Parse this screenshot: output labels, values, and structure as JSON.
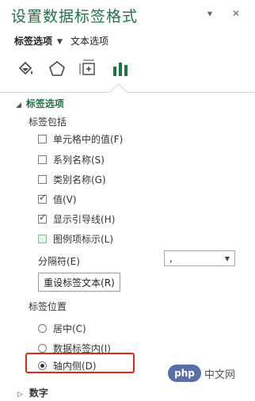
{
  "pane": {
    "title": "设置数据标签格式",
    "collapse_glyph": "▾",
    "close_glyph": "✕"
  },
  "tabs": {
    "label_options": "标签选项",
    "text_options": "文本选项"
  },
  "icons": [
    "fill-line-icon",
    "effects-icon",
    "size-properties-icon",
    "label-options-icon"
  ],
  "accent_color": "#217346",
  "section": {
    "title": "标签选项",
    "label_contains": "标签包括",
    "checkboxes": [
      {
        "label": "单元格中的值(F)",
        "checked": false
      },
      {
        "label": "系列名称(S)",
        "checked": false
      },
      {
        "label": "类别名称(G)",
        "checked": false
      },
      {
        "label": "值(V)",
        "checked": true
      },
      {
        "label": "显示引导线(H)",
        "checked": true
      },
      {
        "label": "图例项标示(L)",
        "checked": false
      }
    ],
    "separator_label": "分隔符(E)",
    "separator_value": ",",
    "reset_button": "重设标签文本(R)",
    "position_label": "标签位置",
    "radios": [
      {
        "label": "居中(C)",
        "selected": false
      },
      {
        "label": "数据标签内(I)",
        "selected": false
      },
      {
        "label": "轴内侧(D)",
        "selected": true
      }
    ]
  },
  "bottom_section": {
    "title": "数字"
  },
  "watermark": {
    "logo": "php",
    "text": "中文网"
  }
}
